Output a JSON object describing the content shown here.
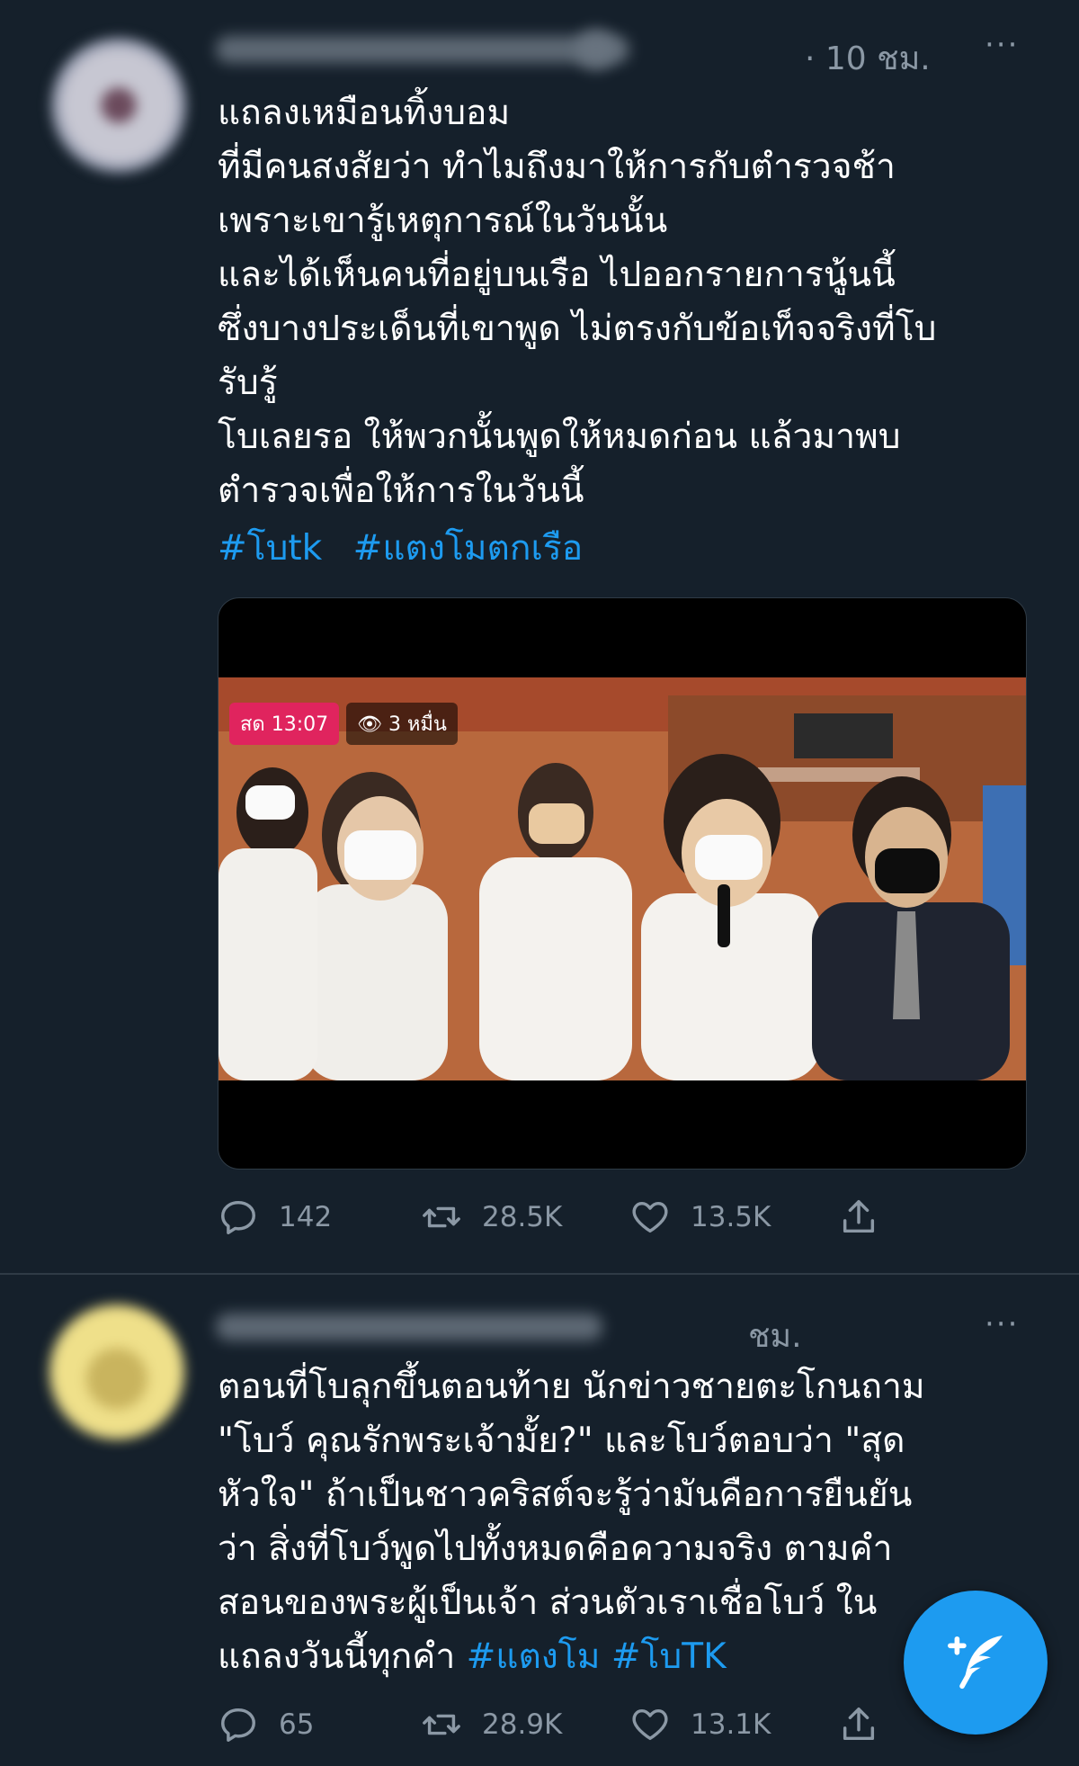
{
  "tweet1": {
    "time": "· 10 ชม.",
    "more": "···",
    "lines": [
      "แถลงเหมือนทิ้งบอม",
      "ที่มีคนสงสัยว่า ทำไมถึงมาให้การกับตำรวจช้า",
      "เพราะเขารู้เหตุการณ์ในวันนั้น",
      "และได้เห็นคนที่อยู่บนเรือ ไปออกรายการนู้นนี้",
      "ซึ่งบางประเด็นที่เขาพูด ไม่ตรงกับข้อเท็จจริงที่โบ",
      "รับรู้",
      "โบเลยรอ ให้พวกนั้นพูดให้หมดก่อน แล้วมาพบ",
      "ตำรวจเพื่อให้การในวันนี้"
    ],
    "hashtags": [
      "#โบtk",
      "#แตงโมตกเรือ"
    ],
    "media": {
      "live_label": "สด 13:07",
      "views_label": "3 หมื่น"
    },
    "stats": {
      "replies": "142",
      "retweets": "28.5K",
      "likes": "13.5K"
    }
  },
  "tweet2": {
    "time": "ชม.",
    "more": "···",
    "lines": [
      "ตอนที่โบลุกขึ้นตอนท้าย นักข่าวชายตะโกนถาม",
      "\"โบว์ คุณรักพระเจ้ามั้ย?\" และโบว์ตอบว่า \"สุด",
      "หัวใจ\" ถ้าเป็นชาวคริสต์จะรู้ว่ามันคือการยืนยัน",
      "ว่า สิ่งที่โบว์พูดไปทั้งหมดคือความจริง ตามคำ",
      "สอนของพระผู้เป็นเจ้า ส่วนตัวเราเชื่อโบว์ ใน"
    ],
    "last_line_text": "แถลงวันนี้ทุกคำ ",
    "hashtags": [
      "#แตงโม",
      "#โบTK"
    ],
    "stats": {
      "replies": "65",
      "retweets": "28.9K",
      "likes": "13.1K"
    }
  },
  "icons": {
    "reply": "reply-icon",
    "retweet": "retweet-icon",
    "like": "heart-icon",
    "share": "share-icon",
    "compose": "compose-tweet-icon"
  },
  "colors": {
    "background": "#15202b",
    "accent": "#1d9bf0",
    "muted": "#8b98a5",
    "live": "#e0245e"
  }
}
